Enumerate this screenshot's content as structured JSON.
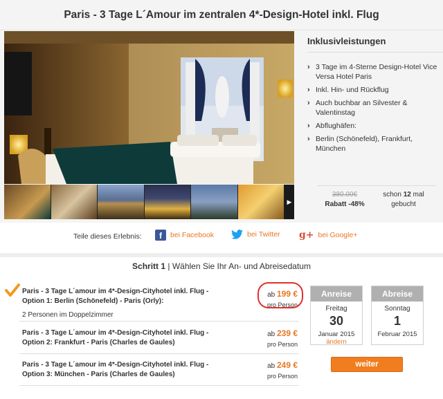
{
  "title": "Paris - 3 Tage L´Amour im zentralen 4*-Design-Hotel inkl. Flug",
  "inclusions": {
    "heading": "Inklusivleistungen",
    "items": [
      "3 Tage im 4-Sterne Design-Hotel Vice Versa Hotel Paris",
      "Inkl. Hin- und Rückflug",
      "Auch buchbar an Silvester & Valentinstag",
      "Abflughäfen:",
      "Berlin (Schönefeld), Frankfurt, München"
    ]
  },
  "pricing": {
    "old_price": "380.00€",
    "discount": "Rabatt -48%",
    "sold_prefix": "schon",
    "sold_count": "12",
    "sold_suffix": "mal",
    "sold_line2": "gebucht"
  },
  "share": {
    "label": "Teile dieses Erlebnis:",
    "facebook": "bei Facebook",
    "twitter": "bei Twitter",
    "google": "bei Google+",
    "facebook_icon": "facebook-icon",
    "twitter_icon": "twitter-icon",
    "google_icon": "google-plus-icon"
  },
  "step": {
    "number": "Schritt 1",
    "separator": "|",
    "text": "Wählen Sie Ihr An- und Abreisedatum"
  },
  "options": [
    {
      "name": "Paris - 3 Tage L´amour im 4*-Design-Cityhotel inkl. Flug - Option 1: Berlin (Schönefeld) - Paris (Orly):",
      "extra": "2 Personen im Doppelzimmer",
      "price_prefix": "ab",
      "price": "199 €",
      "per": "pro Person"
    },
    {
      "name": "Paris - 3 Tage L´amour im 4*-Design-Cityhotel inkl. Flug - Option 2: Frankfurt - Paris (Charles de Gaules)",
      "price_prefix": "ab",
      "price": "239 €",
      "per": "pro Person"
    },
    {
      "name": "Paris - 3 Tage L´amour im 4*-Design-Cityhotel inkl. Flug - Option 3: München - Paris (Charles de Gaules)",
      "price_prefix": "ab",
      "price": "249 €",
      "per": "pro Person"
    }
  ],
  "arrival": {
    "header": "Anreise",
    "weekday": "Freitag",
    "day": "30",
    "month_year": "Januar 2015",
    "change": "ändern"
  },
  "departure": {
    "header": "Abreise",
    "weekday": "Sonntag",
    "day": "1",
    "month_year": "Februar 2015"
  },
  "continue_label": "weiter",
  "colors": {
    "accent": "#e87722",
    "button": "#f07d1e",
    "highlight_circle": "#e0302c",
    "facebook": "#3b5998",
    "twitter": "#1da1f2",
    "google": "#dd4b39"
  }
}
